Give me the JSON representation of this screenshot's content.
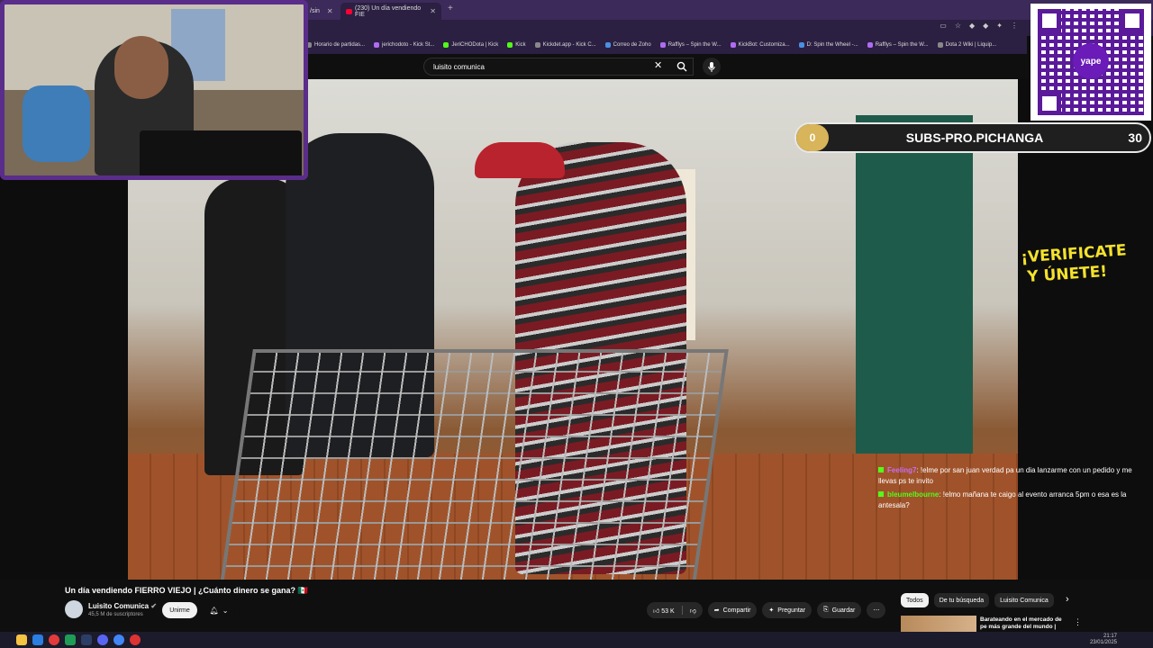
{
  "browser": {
    "tabs": [
      {
        "label": "/sin",
        "active": false
      },
      {
        "label": "(230) Un día vendiendo FIE",
        "active": true
      }
    ],
    "bookmarks": [
      {
        "label": "Horario de partidas...",
        "color": "g"
      },
      {
        "label": "jerichodoto - Kick St...",
        "color": "p"
      },
      {
        "label": "JeriCHODota | Kick",
        "color": ""
      },
      {
        "label": "Kick",
        "color": ""
      },
      {
        "label": "Kickdet.app - Kick C...",
        "color": "g"
      },
      {
        "label": "Correo de Zoho",
        "color": "b"
      },
      {
        "label": "Rafflys – Spin the W...",
        "color": "p"
      },
      {
        "label": "KickBot: Customiza...",
        "color": "p"
      },
      {
        "label": "D: Spin the Wheel -...",
        "color": "b"
      },
      {
        "label": "Rafflys – Spin the W...",
        "color": "p"
      },
      {
        "label": "Dota 2 Wiki | Liquip...",
        "color": "g"
      }
    ]
  },
  "youtube": {
    "search": {
      "query": "luisito comunica"
    },
    "video": {
      "title": "Un día vendiendo FIERRO VIEJO | ¿Cuánto dinero se gana? 🇲🇽",
      "title_flag": "MX"
    },
    "channel": {
      "name": "Luisito Comunica",
      "subscribers": "45,5 M de suscriptores",
      "join_label": "Unirme"
    },
    "actions": {
      "likes": "53 K",
      "share": "Compartir",
      "ask": "Preguntar",
      "save": "Guardar"
    },
    "chips": [
      {
        "label": "Todos",
        "selected": true
      },
      {
        "label": "De tu búsqueda",
        "selected": false
      },
      {
        "label": "Luisito Comunica",
        "selected": false
      }
    ],
    "recommendation": {
      "title": "Barateando en el mercado de pe más grande del mundo |"
    }
  },
  "overlay": {
    "subs_goal": {
      "current": "0",
      "title": "SUBS-PRO.PICHANGA",
      "goal": "30"
    },
    "verify_line1": "¡VERIFICATE",
    "verify_line2": "Y ÚNETE!",
    "qr_brand": "yape",
    "accent": "#5a2d8a",
    "chat": [
      {
        "user": "Feeling7",
        "user_color": "#c86cf0",
        "text": ": !elme por san juan verdad pa un dia lanzarme con un pedido y me llevas ps te invito"
      },
      {
        "user": "bleumelbourne",
        "user_color": "#53fc18",
        "text": ": !elmo mañana te caigo al evento arranca 5pm o esa es la antesala?"
      }
    ]
  },
  "taskbar": {
    "time": "21:17",
    "date": "23/01/2025"
  }
}
